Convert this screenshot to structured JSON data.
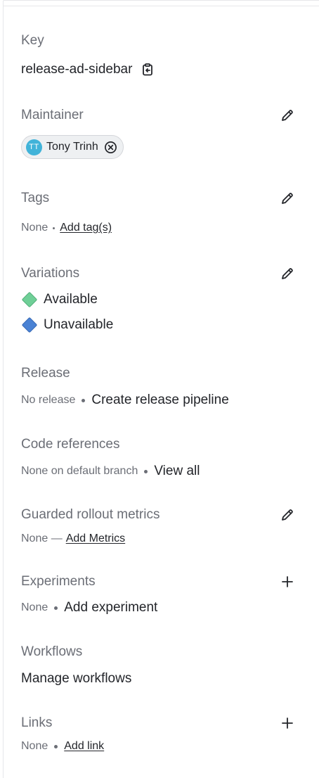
{
  "key": {
    "label": "Key",
    "value": "release-ad-sidebar"
  },
  "maintainer": {
    "label": "Maintainer",
    "initials": "TT",
    "name": "Tony Trinh"
  },
  "tags": {
    "label": "Tags",
    "none": "None",
    "add": "Add tag(s)"
  },
  "variations": {
    "label": "Variations",
    "items": [
      {
        "name": "Available",
        "color": "#6fcf97"
      },
      {
        "name": "Unavailable",
        "color": "#4a82d4"
      }
    ]
  },
  "release": {
    "label": "Release",
    "none": "No release",
    "action": "Create release pipeline"
  },
  "code_refs": {
    "label": "Code references",
    "none": "None on default branch",
    "action": "View all"
  },
  "guarded": {
    "label": "Guarded rollout metrics",
    "none": "None —",
    "action": "Add Metrics"
  },
  "experiments": {
    "label": "Experiments",
    "none": "None",
    "action": "Add experiment"
  },
  "workflows": {
    "label": "Workflows",
    "action": "Manage workflows"
  },
  "links": {
    "label": "Links",
    "none": "None",
    "action": "Add link"
  }
}
